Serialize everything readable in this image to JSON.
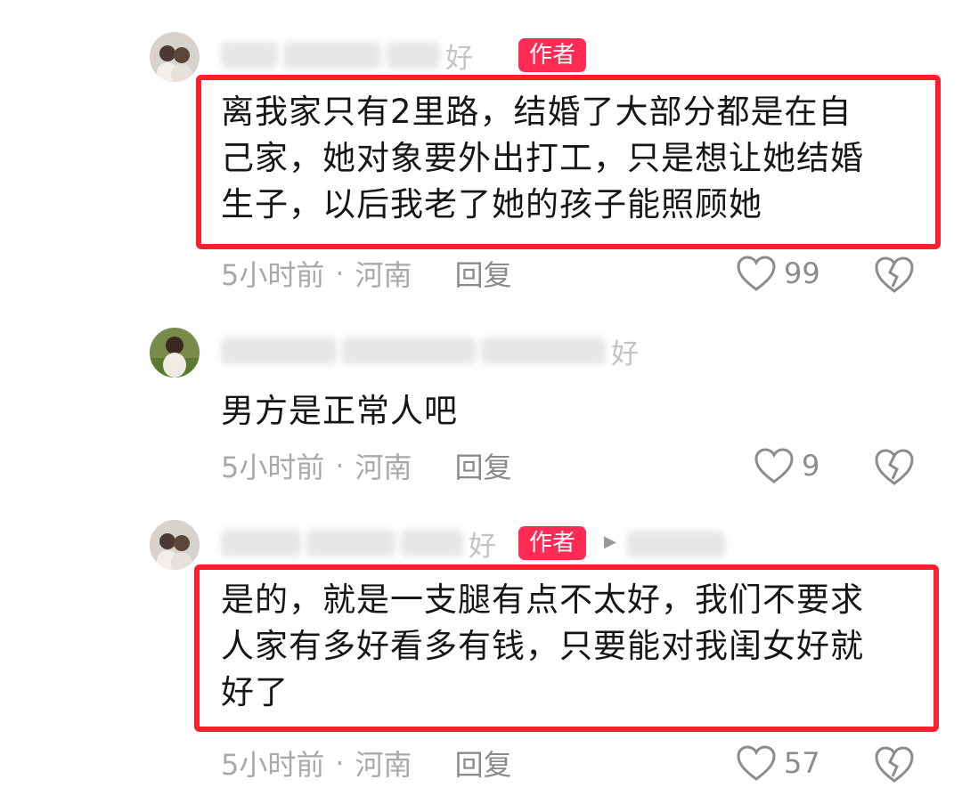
{
  "comments": [
    {
      "username_visible": "好",
      "is_author": true,
      "author_badge": "作者",
      "text": "离我家只有2里路，结婚了大部分都是在自己家，她对象要外出打工，只是想让她结婚生子，以后我老了她的孩子能照顾她",
      "lines": [
        "离我家只有2里路，结婚了大部分都是在自",
        "己家，她对象要外出打工，只是想让她结婚",
        "生子，以后我老了她的孩子能照顾她"
      ],
      "time": "5小时前",
      "separator": "·",
      "location": "河南",
      "reply_label": "回复",
      "likes": "99",
      "highlighted": true
    },
    {
      "username_visible": "好",
      "is_author": false,
      "text": "男方是正常人吧",
      "lines": [
        "男方是正常人吧"
      ],
      "time": "5小时前",
      "separator": "·",
      "location": "河南",
      "reply_label": "回复",
      "likes": "9",
      "highlighted": false
    },
    {
      "username_visible": "好",
      "is_author": true,
      "author_badge": "作者",
      "text": "是的，就是一支腿有点不太好，我们不要求人家有多好看多有钱，只要能对我闺女好就好了",
      "lines": [
        "是的，就是一支腿有点不太好，我们不要求",
        "人家有多好看多有钱，只要能对我闺女好就",
        "好了"
      ],
      "time": "5小时前",
      "separator": "·",
      "location": "河南",
      "reply_label": "回复",
      "likes": "57",
      "highlighted": true
    }
  ],
  "colors": {
    "highlight_border": "#ff1f2a",
    "author_badge": "#fe2c55",
    "meta_text": "#a9a9a9",
    "body_text": "#161616"
  },
  "icons": {
    "like": "heart-outline-icon",
    "dislike": "broken-heart-icon",
    "play": "play-triangle-icon"
  }
}
